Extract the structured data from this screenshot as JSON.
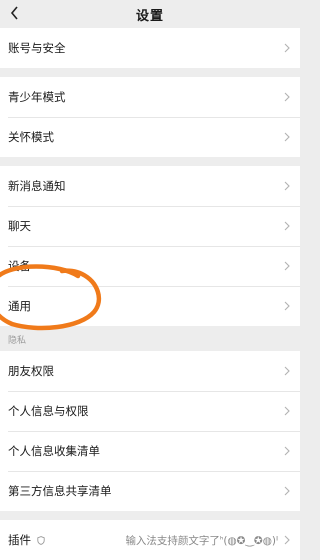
{
  "nav": {
    "title": "设置"
  },
  "groups": [
    {
      "items": [
        {
          "label": "账号与安全"
        }
      ]
    },
    {
      "items": [
        {
          "label": "青少年模式"
        },
        {
          "label": "关怀模式"
        }
      ]
    },
    {
      "items": [
        {
          "label": "新消息通知"
        },
        {
          "label": "聊天"
        },
        {
          "label": "设备"
        },
        {
          "label": "通用"
        }
      ]
    }
  ],
  "privacy_section": {
    "header": "隐私",
    "items": [
      {
        "label": "朋友权限"
      },
      {
        "label": "个人信息与权限"
      },
      {
        "label": "个人信息收集清单"
      },
      {
        "label": "第三方信息共享清单"
      }
    ]
  },
  "plugin": {
    "label": "插件",
    "ime_text": "输入法支持颜文字了ᑋ(◍✪‿✪◍)ᑊ"
  },
  "annotation": {
    "circle_color": "#f07a1a"
  },
  "icons": {
    "back": "chevron-left-icon",
    "row_arrow": "chevron-right-icon",
    "plugin_badge": "shield-icon"
  }
}
